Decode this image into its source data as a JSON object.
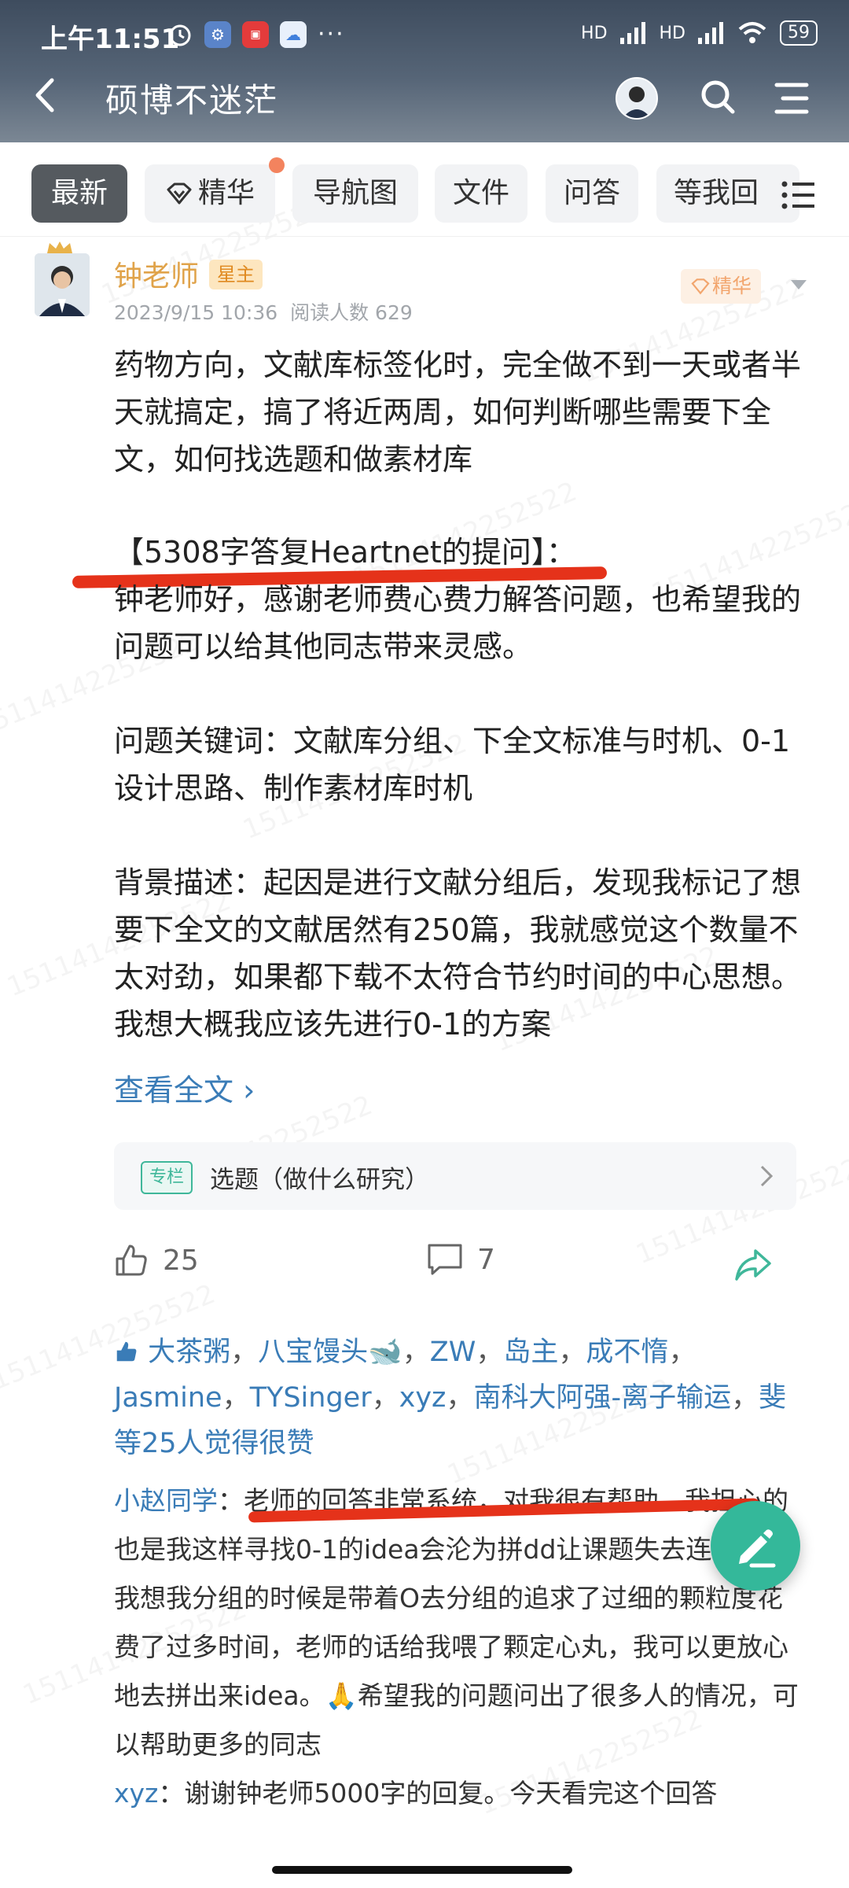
{
  "status_bar": {
    "time": "上午11:51",
    "network_labels": [
      "HD",
      "HD"
    ],
    "battery": "59"
  },
  "header": {
    "title": "硕博不迷茫"
  },
  "tabs": [
    "最新",
    "精华",
    "导航图",
    "文件",
    "问答",
    "等我回"
  ],
  "post": {
    "author": "钟老师",
    "author_badge": "星主",
    "date": "2023/9/15 10:36",
    "reads": "阅读人数 629",
    "essence_badge": "精华",
    "paragraphs": [
      "药物方向，文献库标签化时，完全做不到一天或者半天就搞定，搞了将近两周，如何判断哪些需要下全文，如何找选题和做素材库",
      "【5308字答复Heartnet的提问】：",
      "钟老师好，感谢老师费心费力解答问题，也希望我的问题可以给其他同志带来灵感。",
      "问题关键词：文献库分组、下全文标准与时机、0-1设计思路、制作素材库时机",
      "背景描述：起因是进行文献分组后，发现我标记了想要下全文的文献居然有250篇，我就感觉这个数量不太对劲，如果都下载不太符合节约时间的中心思想。我想大概我应该先进行0-1的方案"
    ],
    "read_more": "查看全文 ›",
    "column_tag": "专栏",
    "column_title": "选题（做什么研究）",
    "likes": "25",
    "comments_count": "7"
  },
  "likers": {
    "names": [
      "大茶粥",
      "八宝馒头🐋",
      "ZW",
      "岛主",
      "成不惰",
      "Jasmine",
      "TYSinger",
      "xyz",
      "南科大阿强-离子输运",
      "斐"
    ],
    "suffix": "等25人觉得很赞"
  },
  "comments": [
    {
      "author": "小赵同学",
      "text": "：老师的回答非常系统，对我很有帮助。我担心的也是我这样寻找0-1的idea会沦为拼dd让课题失去连贯性。我想我分组的时候是带着O去分组的追求了过细的颗粒度花费了过多时间，老师的话给我喂了颗定心丸，我可以更放心地去拼出来idea。🙏希望我的问题问出了很多人的情况，可以帮助更多的同志"
    },
    {
      "author": "xyz",
      "text": "：谢谢钟老师5000字的回复。今天看完这个回答"
    }
  ],
  "watermark": "15114142252522",
  "colors": {
    "accent_blue": "#3a7cb7",
    "gold": "#e0a34a",
    "fab_green": "#34b89a",
    "highlight_red": "#e5321a"
  }
}
